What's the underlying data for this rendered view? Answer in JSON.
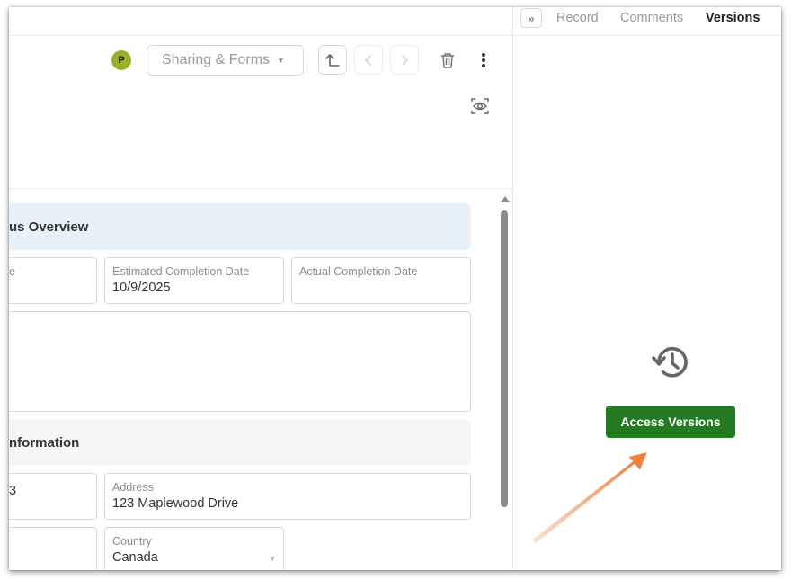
{
  "header": {
    "avatar_initial": "P",
    "sharing_label": "Sharing & Forms"
  },
  "sections": [
    {
      "title": "us Overview"
    },
    {
      "title": "nformation"
    }
  ],
  "fields": {
    "row1_col1_label": "e",
    "estimated_completion": {
      "label": "Estimated Completion Date",
      "value": "10/9/2025"
    },
    "actual_completion": {
      "label": "Actual Completion Date",
      "value": ""
    },
    "row3_col1_value": "3",
    "address": {
      "label": "Address",
      "value": "123 Maplewood Drive"
    },
    "country": {
      "label": "Country",
      "value": "Canada"
    }
  },
  "right_panel": {
    "tabs": [
      {
        "label": "Record",
        "active": false
      },
      {
        "label": "Comments",
        "active": false
      },
      {
        "label": "Versions",
        "active": true
      }
    ],
    "access_button_label": "Access Versions"
  },
  "colors": {
    "accent_green": "#237a22",
    "annotation_arrow": "#f07a2e",
    "section_blue": "#e8f1f8",
    "avatar": "#98b02a"
  },
  "icons": [
    "avatar",
    "caret-down-icon",
    "up-arrow-icon",
    "chevron-left-icon",
    "chevron-right-icon",
    "trash-icon",
    "more-vertical-icon",
    "preview-eye-icon",
    "double-chevron-right-icon",
    "history-icon",
    "annotation-arrow"
  ]
}
